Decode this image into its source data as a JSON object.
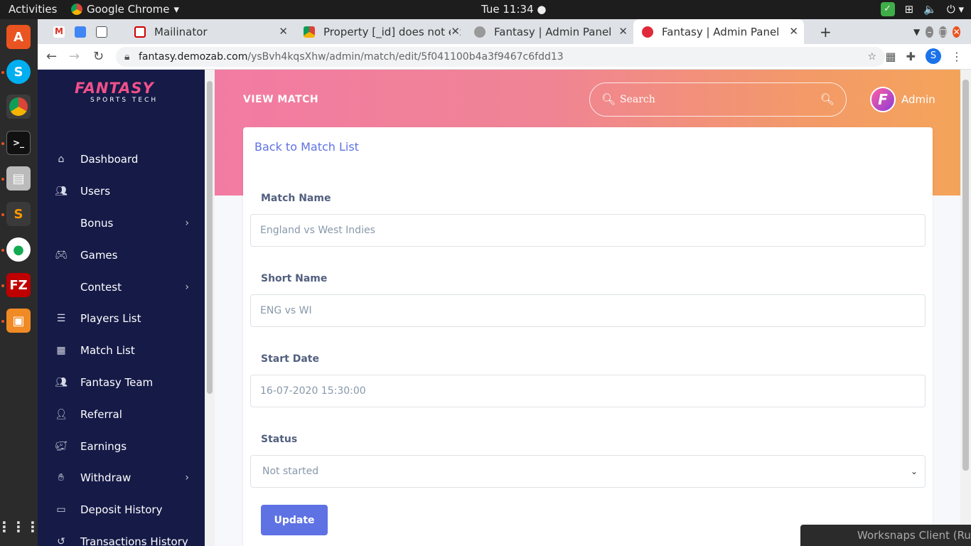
{
  "os": {
    "activities": "Activities",
    "app_name": "Google Chrome",
    "clock": "Tue 11:34"
  },
  "tabs": [
    {
      "label": ""
    },
    {
      "label": "Mailinator"
    },
    {
      "label": "Property [_id] does not ex"
    },
    {
      "label": "Fantasy | Admin Panel"
    },
    {
      "label": "Fantasy | Admin Panel"
    }
  ],
  "address": {
    "host": "fantasy.demozab.com",
    "path": "/ysBvh4kqsXhw/admin/match/edit/5f041100b4a3f9467c6fdd13",
    "profile_initial": "S"
  },
  "sidebar": {
    "logo_main": "FANTASY",
    "logo_sub": "SPORTS TECH",
    "items": [
      {
        "label": "Dashboard",
        "icon": "home-icon"
      },
      {
        "label": "Users",
        "icon": "users-icon"
      },
      {
        "label": "Bonus",
        "icon": "",
        "has_sub": true
      },
      {
        "label": "Games",
        "icon": "gamepad-icon"
      },
      {
        "label": "Contest",
        "icon": "",
        "has_sub": true
      },
      {
        "label": "Players List",
        "icon": "list-icon"
      },
      {
        "label": "Match List",
        "icon": "calendar-icon"
      },
      {
        "label": "Fantasy Team",
        "icon": "team-icon"
      },
      {
        "label": "Referral",
        "icon": "user-plus-icon"
      },
      {
        "label": "Earnings",
        "icon": "piggy-bank-icon"
      },
      {
        "label": "Withdraw",
        "icon": "hand-money-icon",
        "has_sub": true
      },
      {
        "label": "Deposit History",
        "icon": "money-bill-icon"
      },
      {
        "label": "Transactions History",
        "icon": "history-icon"
      }
    ]
  },
  "header": {
    "title": "VIEW MATCH",
    "search_placeholder": "Search",
    "avatar_letter": "F",
    "user": "Admin"
  },
  "form": {
    "back_link": "Back to Match List",
    "match_name_label": "Match Name",
    "match_name_value": "England vs West Indies",
    "short_name_label": "Short Name",
    "short_name_value": "ENG vs WI",
    "start_date_label": "Start Date",
    "start_date_value": "16-07-2020 15:30:00",
    "status_label": "Status",
    "status_value": "Not started",
    "update_label": "Update"
  },
  "overlay": {
    "worksnaps": "Worksnaps Client (Ru"
  },
  "colors": {
    "sidebar_bg": "#151a47",
    "accent": "#5e72e4",
    "hero_start": "#f27ba3",
    "hero_end": "#f4a45a"
  }
}
